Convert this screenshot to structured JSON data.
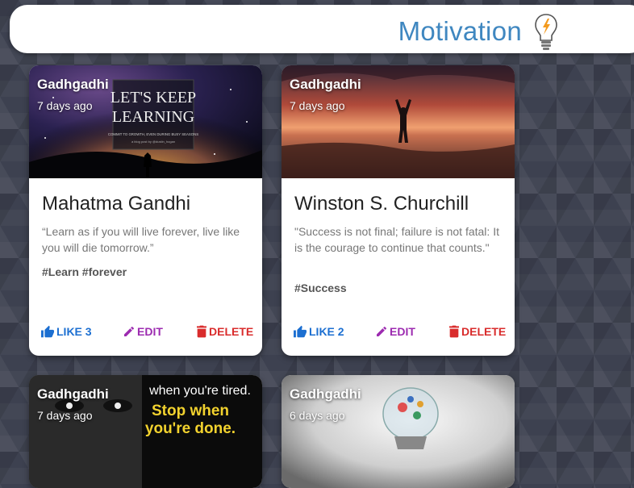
{
  "app": {
    "title": "Motivation",
    "accent": "#3f87c0"
  },
  "cards": [
    {
      "author": "Gadhgadhi",
      "time": "7 days ago",
      "title": "Mahatma Gandhi",
      "quote": "“Learn as if you will live forever, live like you will die tomorrow.”",
      "tags": "#Learn #forever",
      "like_label": "LIKE 3",
      "edit_label": "EDIT",
      "delete_label": "DELETE",
      "image_text": {
        "line1": "LET'S KEEP",
        "line2": "LEARNING",
        "line3": "COMMIT TO GROWTH, EVEN DURING BUSY SEASONS",
        "line4": "a blog post by @dustin_hogan"
      }
    },
    {
      "author": "Gadhgadhi",
      "time": "7 days ago",
      "title": "Winston S. Churchill",
      "quote": "\"Success is not final; failure is not fatal: It is the courage to continue that counts.\"",
      "tags": "#Success",
      "like_label": "LIKE 2",
      "edit_label": "EDIT",
      "delete_label": "DELETE"
    },
    {
      "author": "Gadhgadhi",
      "time": "7 days ago",
      "image_text": {
        "line1": "when you're tired.",
        "line2": "Stop when",
        "line3": "you're done."
      }
    },
    {
      "author": "Gadhgadhi",
      "time": "6 days ago"
    }
  ],
  "colors": {
    "like": "#1c6fd1",
    "edit": "#9c2bb0",
    "delete": "#d92c2c"
  }
}
